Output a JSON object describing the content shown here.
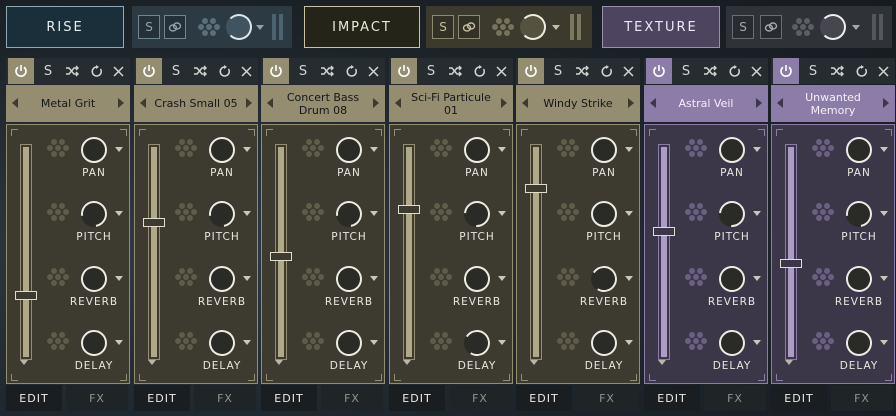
{
  "colors": {
    "olive": "#948d6f",
    "olive_light": "#b0a987",
    "olive_dark": "#3d3b2f",
    "lilac": "#8c7ca8",
    "lilac_light": "#ab9dc6",
    "lilac_dark": "#3c3748",
    "topbar_bg": "#2a3238",
    "dark": "#1a1e21"
  },
  "groups": [
    {
      "label": "RISE",
      "selected": true,
      "solo_label": "S",
      "link_icon": "link-icon"
    },
    {
      "label": "IMPACT",
      "selected": false,
      "solo_label": "S",
      "link_icon": "link-icon"
    },
    {
      "label": "TEXTURE",
      "selected": false,
      "solo_label": "S",
      "link_icon": "link-icon"
    }
  ],
  "strip_icons": {
    "power": "power-icon",
    "solo": "S",
    "shuffle": "shuffle-icon",
    "reset": "reset-icon",
    "close": "close-icon"
  },
  "knob_labels": [
    "PAN",
    "PITCH",
    "REVERB",
    "DELAY"
  ],
  "tabs": {
    "edit": "EDIT",
    "fx": "FX"
  },
  "strips": [
    {
      "name": "Metal Grit",
      "theme": "olive",
      "fader_level": 0.3,
      "knobs": [
        0.5,
        0.3,
        0.75,
        0.65
      ]
    },
    {
      "name": "Crash Small 05",
      "theme": "olive",
      "fader_level": 0.64,
      "knobs": [
        0.5,
        0.3,
        0.55,
        0.6
      ]
    },
    {
      "name": "Concert Bass Drum 08",
      "theme": "olive",
      "fader_level": 0.48,
      "knobs": [
        0.5,
        0.3,
        0.8,
        0.85
      ]
    },
    {
      "name": "Sci-Fi Particule 01",
      "theme": "olive",
      "fader_level": 0.7,
      "knobs": [
        0.5,
        0.35,
        0.55,
        0.45
      ]
    },
    {
      "name": "Windy Strike",
      "theme": "olive",
      "fader_level": 0.8,
      "knobs": [
        0.5,
        0.5,
        0.45,
        0.65
      ]
    },
    {
      "name": "Astral Veil",
      "theme": "lilac",
      "fader_level": 0.6,
      "knobs": [
        0.5,
        0.35,
        0.8,
        0.65
      ]
    },
    {
      "name": "Unwanted Memory",
      "theme": "lilac",
      "fader_level": 0.45,
      "knobs": [
        0.5,
        0.3,
        0.6,
        0.55
      ]
    }
  ]
}
